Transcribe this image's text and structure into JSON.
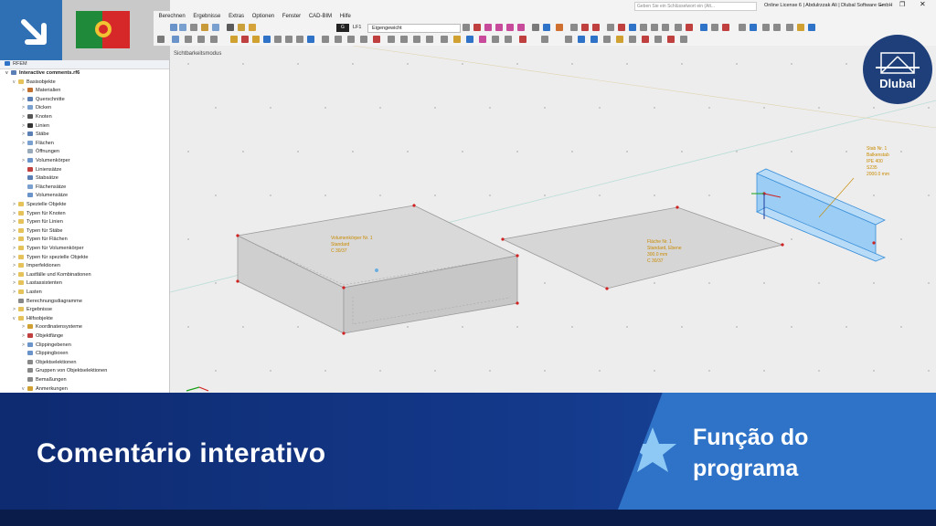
{
  "window": {
    "search_placeholder": "Geben Sie ein Schlüsselwort ein (Alt...",
    "license_text": "Online License 6 | Abdulrzzak Ali | Dlubal Software GmbH"
  },
  "menubar": {
    "items": [
      "Berechnen",
      "Ergebnisse",
      "Extras",
      "Optionen",
      "Fenster",
      "CAD-BIM",
      "Hilfe"
    ]
  },
  "toolbar": {
    "loadcase_type": "G",
    "loadcase_id": "LF1",
    "loadcase_name": "Eigengewicht"
  },
  "navigator": {
    "title": "RFEM",
    "file": "Interactive comments.rf6",
    "items": [
      {
        "label": "Basisobjekte",
        "level": 1,
        "caret": "v",
        "icon": "folder"
      },
      {
        "label": "Materialien",
        "level": 2,
        "caret": ">",
        "icon": "material"
      },
      {
        "label": "Querschnitte",
        "level": 2,
        "caret": ">",
        "icon": "section"
      },
      {
        "label": "Dicken",
        "level": 2,
        "caret": ">",
        "icon": "thickness"
      },
      {
        "label": "Knoten",
        "level": 2,
        "caret": ">",
        "icon": "node"
      },
      {
        "label": "Linien",
        "level": 2,
        "caret": ">",
        "icon": "line"
      },
      {
        "label": "Stäbe",
        "level": 2,
        "caret": ">",
        "icon": "member"
      },
      {
        "label": "Flächen",
        "level": 2,
        "caret": ">",
        "icon": "surface"
      },
      {
        "label": "Öffnungen",
        "level": 2,
        "caret": "",
        "icon": "opening"
      },
      {
        "label": "Volumenkörper",
        "level": 2,
        "caret": ">",
        "icon": "solid"
      },
      {
        "label": "Liniensätze",
        "level": 2,
        "caret": "",
        "icon": "lineset"
      },
      {
        "label": "Stabsätze",
        "level": 2,
        "caret": "",
        "icon": "memberset"
      },
      {
        "label": "Flächensätze",
        "level": 2,
        "caret": "",
        "icon": "surfaceset"
      },
      {
        "label": "Volumensätze",
        "level": 2,
        "caret": "",
        "icon": "solidset"
      },
      {
        "label": "Spezielle Objekte",
        "level": 1,
        "caret": ">",
        "icon": "folder"
      },
      {
        "label": "Typen für Knoten",
        "level": 1,
        "caret": ">",
        "icon": "folder"
      },
      {
        "label": "Typen für Linien",
        "level": 1,
        "caret": ">",
        "icon": "folder"
      },
      {
        "label": "Typen für Stäbe",
        "level": 1,
        "caret": ">",
        "icon": "folder"
      },
      {
        "label": "Typen für Flächen",
        "level": 1,
        "caret": ">",
        "icon": "folder"
      },
      {
        "label": "Typen für Volumenkörper",
        "level": 1,
        "caret": ">",
        "icon": "folder"
      },
      {
        "label": "Typen für spezielle Objekte",
        "level": 1,
        "caret": ">",
        "icon": "folder"
      },
      {
        "label": "Imperfektionen",
        "level": 1,
        "caret": ">",
        "icon": "folder"
      },
      {
        "label": "Lastfälle und Kombinationen",
        "level": 1,
        "caret": ">",
        "icon": "folder"
      },
      {
        "label": "Lastassistenten",
        "level": 1,
        "caret": ">",
        "icon": "folder"
      },
      {
        "label": "Lasten",
        "level": 1,
        "caret": ">",
        "icon": "folder"
      },
      {
        "label": "Berechnungsdiagramme",
        "level": 1,
        "caret": "",
        "icon": "diagram"
      },
      {
        "label": "Ergebnisse",
        "level": 1,
        "caret": ">",
        "icon": "folder"
      },
      {
        "label": "Hilfsobjekte",
        "level": 1,
        "caret": "v",
        "icon": "folder"
      },
      {
        "label": "Koordinatensysteme",
        "level": 2,
        "caret": ">",
        "icon": "coord"
      },
      {
        "label": "Objektfänge",
        "level": 2,
        "caret": ">",
        "icon": "snap"
      },
      {
        "label": "Clippingebenen",
        "level": 2,
        "caret": ">",
        "icon": "clipplane"
      },
      {
        "label": "Clippingboxen",
        "level": 2,
        "caret": "",
        "icon": "clipbox"
      },
      {
        "label": "Objektselektionen",
        "level": 2,
        "caret": "",
        "icon": "selection"
      },
      {
        "label": "Gruppen von Objektselektionen",
        "level": 2,
        "caret": "",
        "icon": "selgroup"
      },
      {
        "label": "Bemaßungen",
        "level": 2,
        "caret": "",
        "icon": "dimension"
      },
      {
        "label": "Anmerkungen",
        "level": 2,
        "caret": "v",
        "icon": "note"
      }
    ]
  },
  "viewport": {
    "mode_label": "Sichtbarkeitsmodus",
    "solid_comment": [
      "Volumenkörper Nr. 1",
      "Standard",
      "C 30/37"
    ],
    "surface_comment": [
      "Fläche Nr. 1",
      "Standard, Ebene",
      "300.0 mm",
      "C 30/37"
    ],
    "member_comment": [
      "Stab Nr. 1",
      "Balkenstab",
      "IPE 400",
      "S235",
      "2000.0 mm"
    ]
  },
  "logo": {
    "text": "Dlubal"
  },
  "banner": {
    "title": "Comentário interativo",
    "subtitle": "Função do programa"
  },
  "colors": {
    "accent": "#2f73c8",
    "banner_dark": "#0e2a70",
    "annotation": "#c98a00",
    "node_red": "#d02020",
    "member_blue": "#9ccdf5"
  }
}
